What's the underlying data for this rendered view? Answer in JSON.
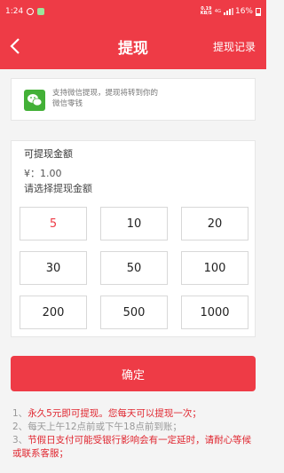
{
  "status_bar": {
    "time": "1:24",
    "speed": "0.19",
    "speed_unit": "KB/S",
    "network": "4G",
    "battery": "16%"
  },
  "header": {
    "title": "提现",
    "record_link": "提现记录",
    "back_icon": "chevron-left-icon"
  },
  "wechat": {
    "icon": "wechat-icon",
    "text": "支持微信提现，提现将转到你的微信零钱"
  },
  "amount": {
    "label": "可提现金额",
    "balance": "¥：1.00",
    "choose_label": "请选择提现金额",
    "options": [
      "5",
      "10",
      "20",
      "30",
      "50",
      "100",
      "200",
      "500",
      "1000"
    ],
    "selected": "5"
  },
  "confirm_label": "确定",
  "notes": [
    {
      "num": "1、",
      "text": "永久5元即可提现。您每天可以提现一次；"
    },
    {
      "num": "2、",
      "text": "每天上午12点前或下午18点前到账；"
    },
    {
      "num": "3、",
      "text": "节假日支付可能受银行影响会有一定延时，请耐心等候或联系客服；"
    }
  ],
  "colors": {
    "accent": "#ee3b46",
    "note_red": "#e0262f",
    "note_gray": "#999999"
  }
}
